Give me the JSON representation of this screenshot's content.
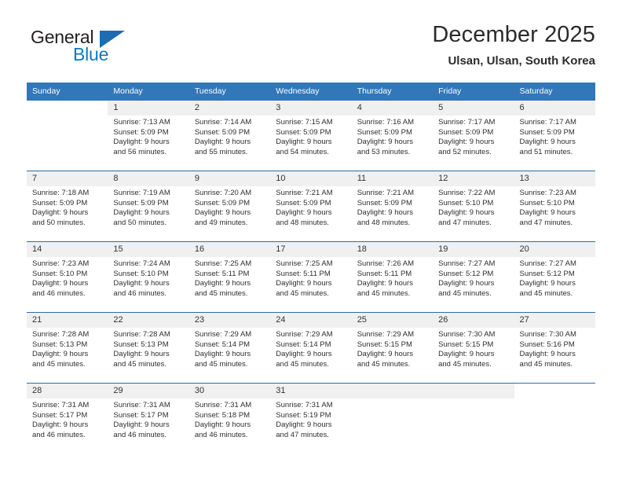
{
  "logo": {
    "primary_text": "General",
    "secondary_text": "Blue",
    "triangle_icon": "triangle-icon",
    "primary_color": "#231f20",
    "secondary_color": "#1277bf",
    "triangle_color": "#1b6cb0"
  },
  "header": {
    "title": "December 2025",
    "subtitle": "Ulsan, Ulsan, South Korea"
  },
  "theme": {
    "header_row_bg": "#3277b8",
    "header_row_text": "#ffffff",
    "day_number_bg": "#f0f0f0",
    "week_divider": "#2e6da4",
    "body_text": "#2f2f2f"
  },
  "calendar": {
    "weekday_headers": [
      "Sunday",
      "Monday",
      "Tuesday",
      "Wednesday",
      "Thursday",
      "Friday",
      "Saturday"
    ],
    "weeks": [
      [
        {
          "day": "",
          "blank": true,
          "leading": true
        },
        {
          "day": "1",
          "sunrise": "Sunrise: 7:13 AM",
          "sunset": "Sunset: 5:09 PM",
          "daylight_line1": "Daylight: 9 hours",
          "daylight_line2": "and 56 minutes."
        },
        {
          "day": "2",
          "sunrise": "Sunrise: 7:14 AM",
          "sunset": "Sunset: 5:09 PM",
          "daylight_line1": "Daylight: 9 hours",
          "daylight_line2": "and 55 minutes."
        },
        {
          "day": "3",
          "sunrise": "Sunrise: 7:15 AM",
          "sunset": "Sunset: 5:09 PM",
          "daylight_line1": "Daylight: 9 hours",
          "daylight_line2": "and 54 minutes."
        },
        {
          "day": "4",
          "sunrise": "Sunrise: 7:16 AM",
          "sunset": "Sunset: 5:09 PM",
          "daylight_line1": "Daylight: 9 hours",
          "daylight_line2": "and 53 minutes."
        },
        {
          "day": "5",
          "sunrise": "Sunrise: 7:17 AM",
          "sunset": "Sunset: 5:09 PM",
          "daylight_line1": "Daylight: 9 hours",
          "daylight_line2": "and 52 minutes."
        },
        {
          "day": "6",
          "sunrise": "Sunrise: 7:17 AM",
          "sunset": "Sunset: 5:09 PM",
          "daylight_line1": "Daylight: 9 hours",
          "daylight_line2": "and 51 minutes."
        }
      ],
      [
        {
          "day": "7",
          "sunrise": "Sunrise: 7:18 AM",
          "sunset": "Sunset: 5:09 PM",
          "daylight_line1": "Daylight: 9 hours",
          "daylight_line2": "and 50 minutes."
        },
        {
          "day": "8",
          "sunrise": "Sunrise: 7:19 AM",
          "sunset": "Sunset: 5:09 PM",
          "daylight_line1": "Daylight: 9 hours",
          "daylight_line2": "and 50 minutes."
        },
        {
          "day": "9",
          "sunrise": "Sunrise: 7:20 AM",
          "sunset": "Sunset: 5:09 PM",
          "daylight_line1": "Daylight: 9 hours",
          "daylight_line2": "and 49 minutes."
        },
        {
          "day": "10",
          "sunrise": "Sunrise: 7:21 AM",
          "sunset": "Sunset: 5:09 PM",
          "daylight_line1": "Daylight: 9 hours",
          "daylight_line2": "and 48 minutes."
        },
        {
          "day": "11",
          "sunrise": "Sunrise: 7:21 AM",
          "sunset": "Sunset: 5:09 PM",
          "daylight_line1": "Daylight: 9 hours",
          "daylight_line2": "and 48 minutes."
        },
        {
          "day": "12",
          "sunrise": "Sunrise: 7:22 AM",
          "sunset": "Sunset: 5:10 PM",
          "daylight_line1": "Daylight: 9 hours",
          "daylight_line2": "and 47 minutes."
        },
        {
          "day": "13",
          "sunrise": "Sunrise: 7:23 AM",
          "sunset": "Sunset: 5:10 PM",
          "daylight_line1": "Daylight: 9 hours",
          "daylight_line2": "and 47 minutes."
        }
      ],
      [
        {
          "day": "14",
          "sunrise": "Sunrise: 7:23 AM",
          "sunset": "Sunset: 5:10 PM",
          "daylight_line1": "Daylight: 9 hours",
          "daylight_line2": "and 46 minutes."
        },
        {
          "day": "15",
          "sunrise": "Sunrise: 7:24 AM",
          "sunset": "Sunset: 5:10 PM",
          "daylight_line1": "Daylight: 9 hours",
          "daylight_line2": "and 46 minutes."
        },
        {
          "day": "16",
          "sunrise": "Sunrise: 7:25 AM",
          "sunset": "Sunset: 5:11 PM",
          "daylight_line1": "Daylight: 9 hours",
          "daylight_line2": "and 45 minutes."
        },
        {
          "day": "17",
          "sunrise": "Sunrise: 7:25 AM",
          "sunset": "Sunset: 5:11 PM",
          "daylight_line1": "Daylight: 9 hours",
          "daylight_line2": "and 45 minutes."
        },
        {
          "day": "18",
          "sunrise": "Sunrise: 7:26 AM",
          "sunset": "Sunset: 5:11 PM",
          "daylight_line1": "Daylight: 9 hours",
          "daylight_line2": "and 45 minutes."
        },
        {
          "day": "19",
          "sunrise": "Sunrise: 7:27 AM",
          "sunset": "Sunset: 5:12 PM",
          "daylight_line1": "Daylight: 9 hours",
          "daylight_line2": "and 45 minutes."
        },
        {
          "day": "20",
          "sunrise": "Sunrise: 7:27 AM",
          "sunset": "Sunset: 5:12 PM",
          "daylight_line1": "Daylight: 9 hours",
          "daylight_line2": "and 45 minutes."
        }
      ],
      [
        {
          "day": "21",
          "sunrise": "Sunrise: 7:28 AM",
          "sunset": "Sunset: 5:13 PM",
          "daylight_line1": "Daylight: 9 hours",
          "daylight_line2": "and 45 minutes."
        },
        {
          "day": "22",
          "sunrise": "Sunrise: 7:28 AM",
          "sunset": "Sunset: 5:13 PM",
          "daylight_line1": "Daylight: 9 hours",
          "daylight_line2": "and 45 minutes."
        },
        {
          "day": "23",
          "sunrise": "Sunrise: 7:29 AM",
          "sunset": "Sunset: 5:14 PM",
          "daylight_line1": "Daylight: 9 hours",
          "daylight_line2": "and 45 minutes."
        },
        {
          "day": "24",
          "sunrise": "Sunrise: 7:29 AM",
          "sunset": "Sunset: 5:14 PM",
          "daylight_line1": "Daylight: 9 hours",
          "daylight_line2": "and 45 minutes."
        },
        {
          "day": "25",
          "sunrise": "Sunrise: 7:29 AM",
          "sunset": "Sunset: 5:15 PM",
          "daylight_line1": "Daylight: 9 hours",
          "daylight_line2": "and 45 minutes."
        },
        {
          "day": "26",
          "sunrise": "Sunrise: 7:30 AM",
          "sunset": "Sunset: 5:15 PM",
          "daylight_line1": "Daylight: 9 hours",
          "daylight_line2": "and 45 minutes."
        },
        {
          "day": "27",
          "sunrise": "Sunrise: 7:30 AM",
          "sunset": "Sunset: 5:16 PM",
          "daylight_line1": "Daylight: 9 hours",
          "daylight_line2": "and 45 minutes."
        }
      ],
      [
        {
          "day": "28",
          "sunrise": "Sunrise: 7:31 AM",
          "sunset": "Sunset: 5:17 PM",
          "daylight_line1": "Daylight: 9 hours",
          "daylight_line2": "and 46 minutes."
        },
        {
          "day": "29",
          "sunrise": "Sunrise: 7:31 AM",
          "sunset": "Sunset: 5:17 PM",
          "daylight_line1": "Daylight: 9 hours",
          "daylight_line2": "and 46 minutes."
        },
        {
          "day": "30",
          "sunrise": "Sunrise: 7:31 AM",
          "sunset": "Sunset: 5:18 PM",
          "daylight_line1": "Daylight: 9 hours",
          "daylight_line2": "and 46 minutes."
        },
        {
          "day": "31",
          "sunrise": "Sunrise: 7:31 AM",
          "sunset": "Sunset: 5:19 PM",
          "daylight_line1": "Daylight: 9 hours",
          "daylight_line2": "and 47 minutes."
        },
        {
          "day": "",
          "blank": true
        },
        {
          "day": "",
          "blank": true
        },
        {
          "day": "",
          "blank": true,
          "trailing_white": true
        }
      ]
    ]
  }
}
